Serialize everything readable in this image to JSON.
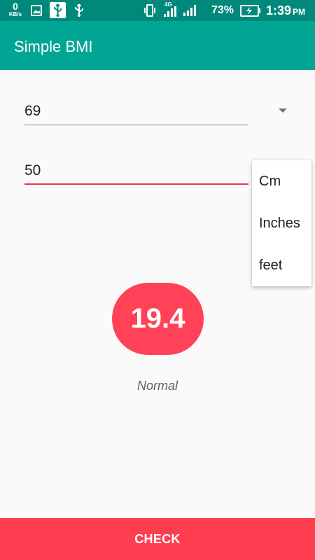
{
  "status_bar": {
    "net_speed": "0",
    "net_speed_unit": "KB/s",
    "battery_percent": "73%",
    "time": "1:39",
    "ampm": "PM",
    "network_type": "4G",
    "icons": [
      "image-icon",
      "usb-debug-icon",
      "usb-icon",
      "vibrate-icon",
      "signal-4g-icon",
      "signal-icon",
      "battery-charging-icon"
    ]
  },
  "app_bar": {
    "title": "Simple BMI"
  },
  "form": {
    "weight_value": "69",
    "height_value": "50"
  },
  "unit_dropdown": {
    "options": [
      "Cm",
      "Inches",
      "feet"
    ]
  },
  "result": {
    "bmi": "19.4",
    "status": "Normal"
  },
  "actions": {
    "check_label": "CHECK"
  },
  "colors": {
    "status_bar": "#00897b",
    "app_bar": "#00a693",
    "accent": "#ff4257",
    "focus_line": "#f0304e"
  }
}
